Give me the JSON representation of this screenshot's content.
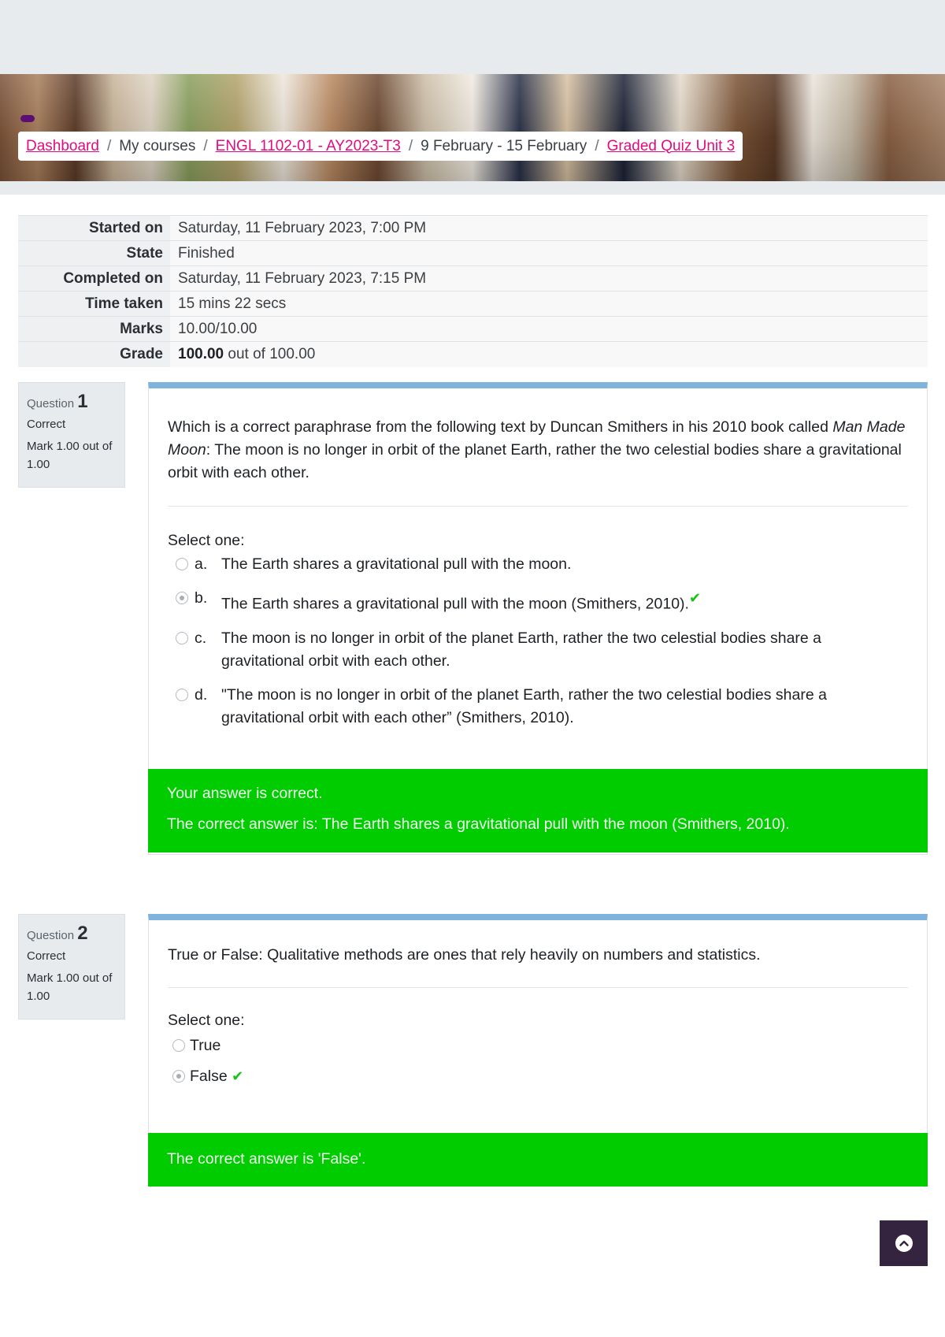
{
  "breadcrumb": {
    "items": [
      {
        "label": "Dashboard",
        "link": true
      },
      {
        "label": "My courses",
        "link": false
      },
      {
        "label": "ENGL 1102-01 - AY2023-T3",
        "link": true
      },
      {
        "label": "9 February - 15 February",
        "link": false
      },
      {
        "label": "Graded Quiz Unit 3",
        "link": true
      }
    ],
    "separator": "/"
  },
  "summary": {
    "rows": [
      {
        "label": "Started on",
        "value": "Saturday, 11 February 2023, 7:00 PM"
      },
      {
        "label": "State",
        "value": "Finished"
      },
      {
        "label": "Completed on",
        "value": "Saturday, 11 February 2023, 7:15 PM"
      },
      {
        "label": "Time taken",
        "value": "15 mins 22 secs"
      },
      {
        "label": "Marks",
        "value": "10.00/10.00"
      },
      {
        "label": "Grade",
        "value_bold": "100.00",
        "value_rest": " out of 100.00"
      }
    ]
  },
  "questions": [
    {
      "label": "Question",
      "number": "1",
      "state": "Correct",
      "grade": "Mark 1.00 out of 1.00",
      "text_before_italic": "Which is a correct paraphrase from the following text by Duncan Smithers in his 2010 book called ",
      "text_italic": "Man Made Moon",
      "text_after_italic": ": The moon is no longer in orbit of the planet Earth, rather the two celestial bodies share a gravitational orbit with each other.",
      "prompt": "Select one:",
      "options": [
        {
          "letter": "a.",
          "text": "The Earth shares a gravitational pull with the moon.",
          "selected": false,
          "correct_mark": false
        },
        {
          "letter": "b.",
          "text": "The Earth shares a gravitational pull with the moon (Smithers, 2010).",
          "selected": true,
          "correct_mark": true
        },
        {
          "letter": "c.",
          "text": "The moon is no longer in orbit of the planet Earth, rather the two celestial bodies share a gravitational orbit with each other.",
          "selected": false,
          "correct_mark": false
        },
        {
          "letter": "d.",
          "text": "\"The moon is no longer in orbit of the planet Earth, rather the two celestial bodies share a gravitational orbit with each other” (Smithers, 2010).",
          "selected": false,
          "correct_mark": false
        }
      ],
      "feedback": "Your answer is correct.",
      "right_answer": "The correct answer is: The Earth shares a gravitational pull with the moon (Smithers, 2010)."
    },
    {
      "label": "Question",
      "number": "2",
      "state": "Correct",
      "grade": "Mark 1.00 out of 1.00",
      "text": "True or False: Qualitative methods are ones that rely heavily on numbers and statistics.",
      "prompt": "Select one:",
      "options": [
        {
          "text": "True",
          "selected": false,
          "correct_mark": false
        },
        {
          "text": "False",
          "selected": true,
          "correct_mark": true
        }
      ],
      "right_answer": "The correct answer is 'False'."
    }
  ],
  "icons": {
    "check": "✔",
    "back_to_top": "chevron-up-circle"
  },
  "colors": {
    "link": "#e30b7f",
    "question_accent": "#7fb3db",
    "correct_bg": "#00cc00",
    "check": "#15c415",
    "back_to_top_bg": "#35243f"
  }
}
